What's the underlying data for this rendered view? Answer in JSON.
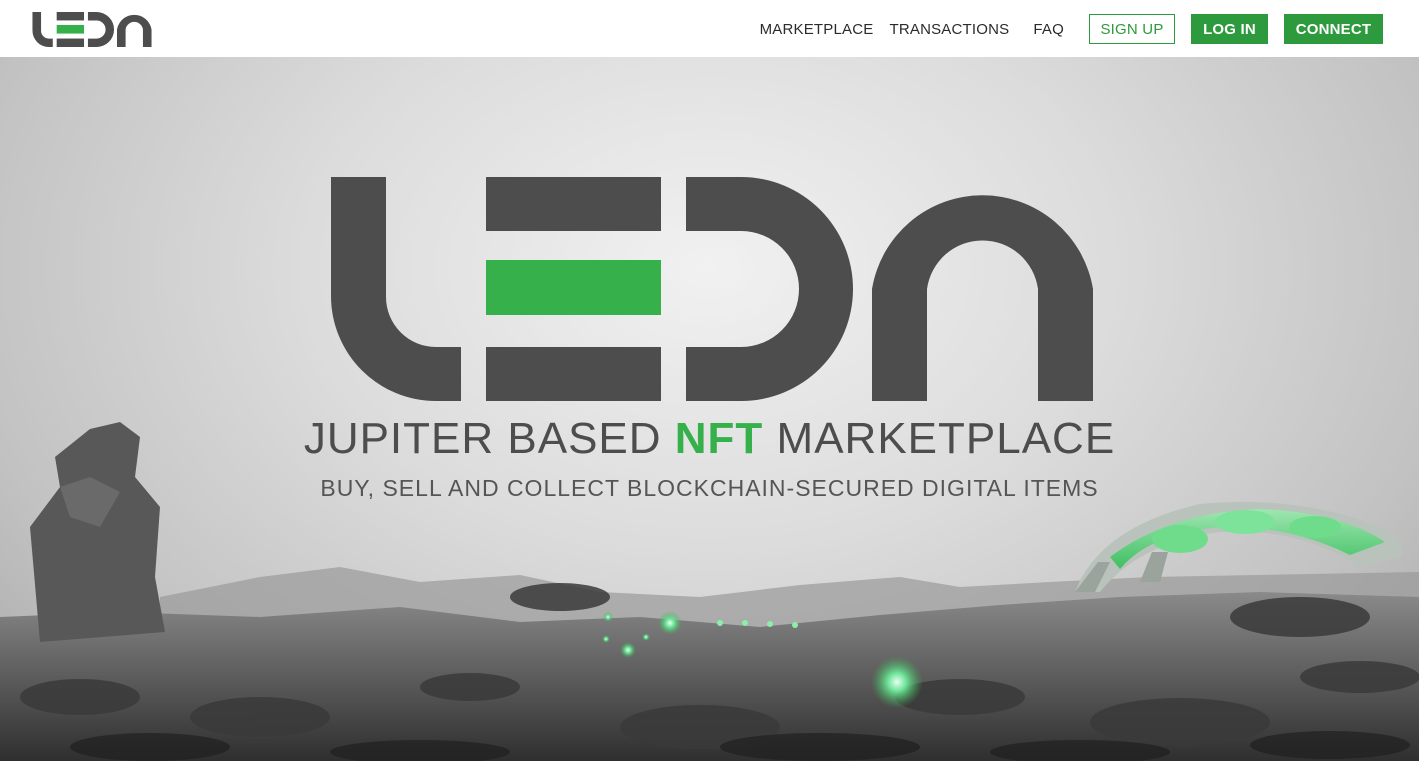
{
  "brand": {
    "name": "LEDN",
    "accent_color": "#35b04a",
    "dark_color": "#4d4d4d",
    "button_color": "#2e9a3e"
  },
  "nav": {
    "marketplace": "MARKETPLACE",
    "transactions": "TRANSACTIONS",
    "faq": "FAQ",
    "sign_up": "SIGN UP",
    "log_in": "LOG IN",
    "connect": "CONNECT"
  },
  "hero": {
    "tagline_before": "JUPITER BASED ",
    "tagline_accent": "NFT",
    "tagline_after": " MARKETPLACE",
    "subtagline": "BUY, SELL AND COLLECT BLOCKCHAIN-SECURED DIGITAL ITEMS"
  },
  "icons": [
    "ledn-logo-icon",
    "ledn-hero-logo-icon",
    "rock-pillar-icon",
    "dome-habitat-icon",
    "glowing-orb-icon"
  ]
}
